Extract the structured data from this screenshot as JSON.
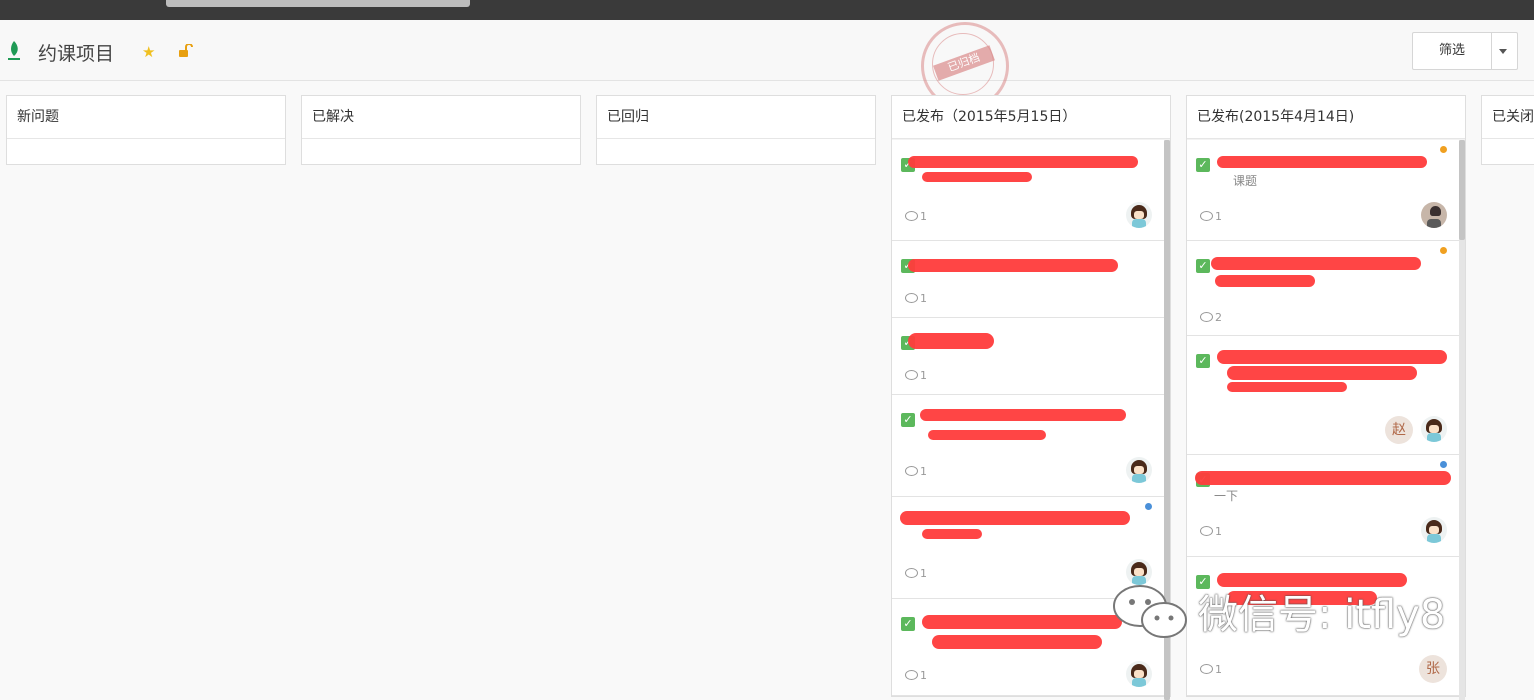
{
  "header": {
    "project_title": "约课项目",
    "filter_label": "筛选",
    "stamp_text": "已归档"
  },
  "columns": [
    {
      "title": "新问题"
    },
    {
      "title": "已解决"
    },
    {
      "title": "已回归"
    },
    {
      "title": "已发布（2015年5月15日）"
    },
    {
      "title": "已发布(2015年4月14日)"
    },
    {
      "title": "已关闭"
    }
  ],
  "column4_cards": [
    {
      "comments": "1"
    },
    {
      "comments": "1"
    },
    {
      "comments": "1"
    },
    {
      "comments": "1"
    },
    {
      "comments": "1"
    },
    {
      "comments": "1"
    }
  ],
  "column5_cards": [
    {
      "comments": "1",
      "text": "课题",
      "dot_color": "#f0a020"
    },
    {
      "comments": "2",
      "dot_color": "#f0a020"
    },
    {
      "comments": "",
      "avatar_label": "赵"
    },
    {
      "comments": "1",
      "text": "一下",
      "dot_color": "#4a90d9"
    },
    {
      "comments": "1",
      "avatar_label": "张"
    }
  ],
  "watermark": {
    "text": "微信号: itfly8"
  },
  "colors": {
    "check": "#5cb85c",
    "redaction": "#ff3b3b",
    "dot_blue": "#4a90d9",
    "dot_orange": "#f0a020"
  }
}
